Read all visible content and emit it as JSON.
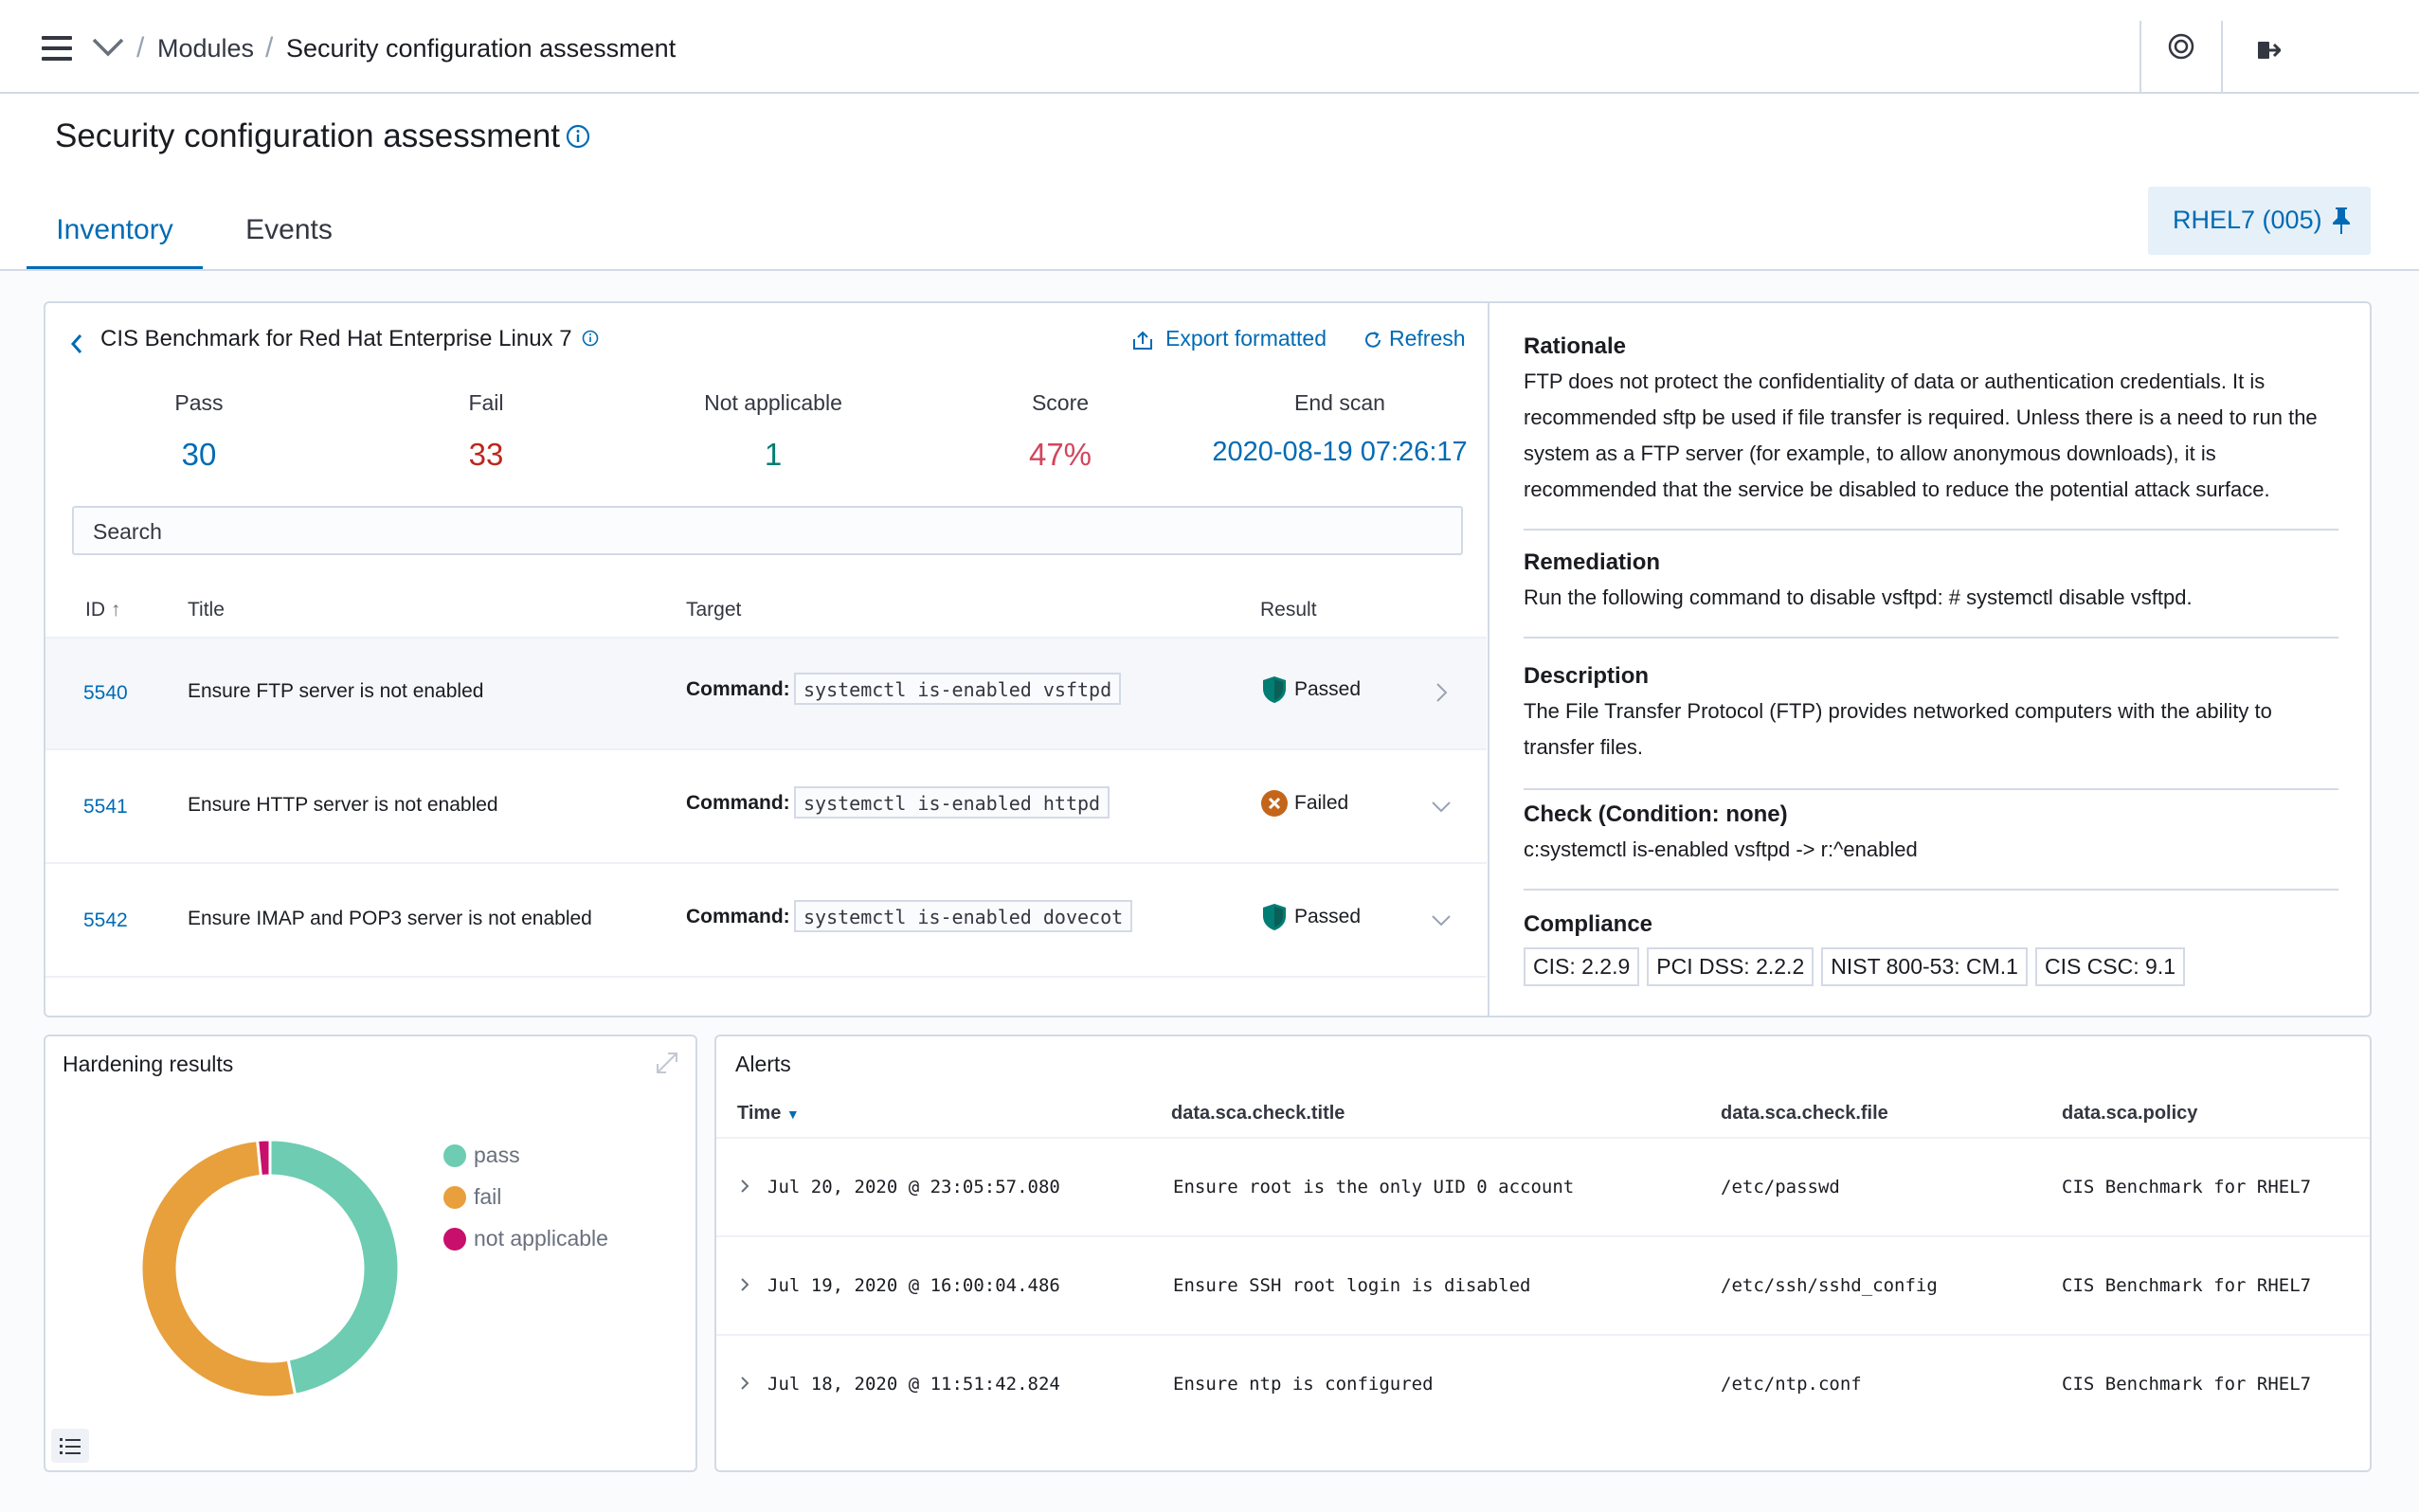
{
  "breadcrumb": {
    "modules": "Modules",
    "separator": "/",
    "current": "Security configuration assessment"
  },
  "page": {
    "title": "Security configuration assessment"
  },
  "tabs": [
    {
      "label": "Inventory",
      "active": true
    },
    {
      "label": "Events",
      "active": false
    }
  ],
  "agent_badge": {
    "label": "RHEL7 (005)"
  },
  "policy": {
    "title": "CIS Benchmark for Red Hat Enterprise Linux 7",
    "export_label": "Export formatted",
    "refresh_label": "Refresh",
    "stats": [
      {
        "label": "Pass",
        "value": "30",
        "color": "#006bb4"
      },
      {
        "label": "Fail",
        "value": "33",
        "color": "#bd271e"
      },
      {
        "label": "Not applicable",
        "value": "1",
        "color": "#017d73"
      },
      {
        "label": "Score",
        "value": "47%",
        "color": "#d3455b"
      },
      {
        "label": "End scan",
        "value": "2020-08-19 07:26:17",
        "color": "#006bb4"
      }
    ],
    "search_placeholder": "Search",
    "columns": {
      "id": "ID",
      "title": "Title",
      "target": "Target",
      "result": "Result"
    },
    "checks": [
      {
        "id": "5540",
        "title": "Ensure FTP server is not enabled",
        "target_label": "Command:",
        "command": "systemctl is-enabled vsftpd",
        "result": "Passed"
      },
      {
        "id": "5541",
        "title": "Ensure HTTP server is not enabled",
        "target_label": "Command:",
        "command": "systemctl is-enabled httpd",
        "result": "Failed"
      },
      {
        "id": "5542",
        "title": "Ensure IMAP and POP3 server is not enabled",
        "target_label": "Command:",
        "command": "systemctl is-enabled dovecot",
        "result": "Passed"
      }
    ]
  },
  "details": {
    "rationale_title": "Rationale",
    "rationale_text": "FTP does not protect the confidentiality of data or authentication credentials. It is recommended sftp be used if file transfer is required. Unless there is a need to run the system as a FTP server (for example, to allow anonymous downloads), it is recommended that the service be disabled to reduce the potential attack surface.",
    "remediation_title": "Remediation",
    "remediation_text": "Run the following command to disable vsftpd: # systemctl disable vsftpd.",
    "description_title": "Description",
    "description_text": "The File Transfer Protocol (FTP) provides networked computers with the ability to transfer files.",
    "check_title": "Check (Condition: none)",
    "check_text": "c:systemctl is-enabled vsftpd -> r:^enabled",
    "compliance_title": "Compliance",
    "compliance_tags": [
      "CIS: 2.2.9",
      "PCI DSS: 2.2.2",
      "NIST 800-53: CM.1",
      "CIS CSC: 9.1"
    ]
  },
  "hardening": {
    "title": "Hardening results",
    "legend": [
      {
        "label": "pass",
        "color": "#6dccb1"
      },
      {
        "label": "fail",
        "color": "#e7a03c"
      },
      {
        "label": "not applicable",
        "color": "#c80f6b"
      }
    ],
    "values": {
      "pass": 30,
      "fail": 33,
      "not_applicable": 1
    }
  },
  "alerts": {
    "title": "Alerts",
    "columns": {
      "time": "Time",
      "check_title": "data.sca.check.title",
      "check_file": "data.sca.check.file",
      "policy": "data.sca.policy"
    },
    "rows": [
      {
        "time": "Jul 20, 2020 @ 23:05:57.080",
        "check_title": "Ensure root is the only UID 0 account",
        "check_file": "/etc/passwd",
        "policy": "CIS Benchmark for RHEL7"
      },
      {
        "time": "Jul 19, 2020 @ 16:00:04.486",
        "check_title": "Ensure SSH root login is disabled",
        "check_file": "/etc/ssh/sshd_config",
        "policy": "CIS Benchmark for RHEL7"
      },
      {
        "time": "Jul 18, 2020 @ 11:51:42.824",
        "check_title": "Ensure ntp is configured",
        "check_file": "/etc/ntp.conf",
        "policy": "CIS Benchmark for RHEL7"
      }
    ]
  },
  "icons": {
    "menu": "hamburger-icon",
    "breadcrumb_toggle": "chevron-down-icon",
    "help": "help-ring-icon",
    "logout": "logout-icon",
    "info": "info-icon",
    "pin": "pin-icon",
    "back": "chevron-left-icon",
    "export": "export-icon",
    "refresh": "refresh-icon",
    "passed": "shield-check-icon",
    "failed": "x-circle-icon",
    "expand": "expand-icon",
    "list": "list-icon",
    "row_expand": "chevron-right-icon"
  }
}
